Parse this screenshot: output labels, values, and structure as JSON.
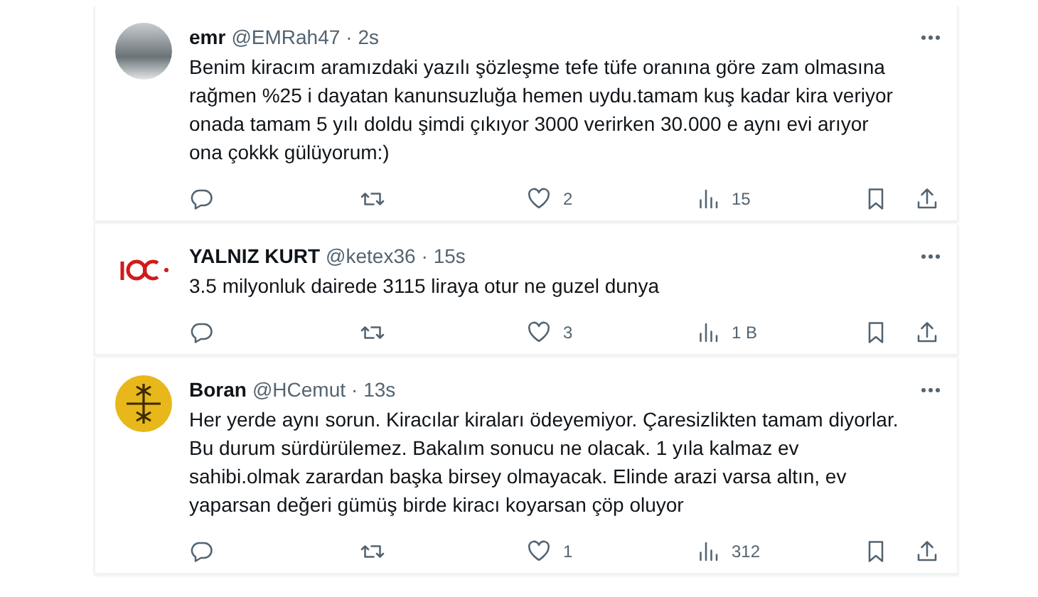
{
  "tweets": [
    {
      "kind": "photo",
      "name": "emr",
      "handle": "@EMRah47",
      "time": "· 2s",
      "text": "Benim kiracım aramızdaki yazılı şözleşme tefe tüfe oranına göre zam olmasına rağmen %25 i dayatan kanunsuzluğa hemen uydu.tamam kuş kadar kira veriyor onada tamam 5 yılı doldu şimdi çıkıyor 3000 verirken 30.000 e aynı evi arıyor ona çokkk gülüyorum:)",
      "likes": "2",
      "views": "15"
    },
    {
      "kind": "logo",
      "name": "YALNIZ KURT",
      "handle": "@ketex36",
      "time": "· 15s",
      "text": "3.5 milyonluk dairede 3115 liraya otur ne guzel dunya",
      "likes": "3",
      "views": "1 B"
    },
    {
      "kind": "emblem",
      "name": "Boran",
      "handle": "@HCemut",
      "time": "· 13s",
      "text": "Her yerde aynı sorun. Kiracılar kiraları ödeyemiyor. Çaresizlikten tamam diyorlar. Bu durum sürdürülemez. Bakalım sonucu ne olacak.  1 yıla kalmaz ev sahibi.olmak zarardan başka birsey olmayacak. Elinde arazi varsa altın, ev yaparsan değeri gümüş birde kiracı koyarsan çöp oluyor",
      "likes": "1",
      "views": "312"
    }
  ]
}
